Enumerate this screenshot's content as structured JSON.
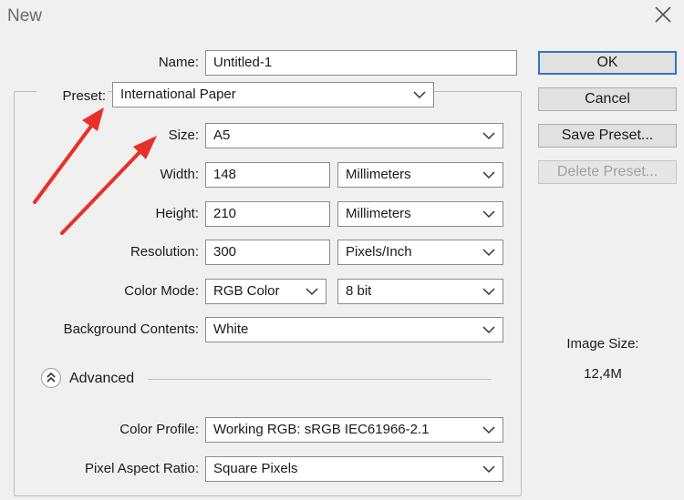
{
  "window": {
    "title": "New"
  },
  "form": {
    "name": {
      "label": "Name:",
      "value": "Untitled-1"
    },
    "preset": {
      "label": "Preset:",
      "value": "International Paper"
    },
    "size": {
      "label": "Size:",
      "value": "A5"
    },
    "width": {
      "label": "Width:",
      "value": "148",
      "unit": "Millimeters"
    },
    "height": {
      "label": "Height:",
      "value": "210",
      "unit": "Millimeters"
    },
    "resolution": {
      "label": "Resolution:",
      "value": "300",
      "unit": "Pixels/Inch"
    },
    "color_mode": {
      "label": "Color Mode:",
      "value": "RGB Color",
      "depth": "8 bit"
    },
    "background": {
      "label": "Background Contents:",
      "value": "White"
    },
    "advanced": {
      "label": "Advanced"
    },
    "color_profile": {
      "label": "Color Profile:",
      "value": "Working RGB:  sRGB IEC61966-2.1"
    },
    "pixel_aspect": {
      "label": "Pixel Aspect Ratio:",
      "value": "Square Pixels"
    }
  },
  "buttons": {
    "ok": "OK",
    "cancel": "Cancel",
    "save_preset": "Save Preset...",
    "delete_preset": "Delete Preset..."
  },
  "image_size": {
    "label": "Image Size:",
    "value": "12,4M"
  },
  "colors": {
    "annotation_arrow": "#e8302a",
    "default_button_border": "#2f74c8"
  }
}
